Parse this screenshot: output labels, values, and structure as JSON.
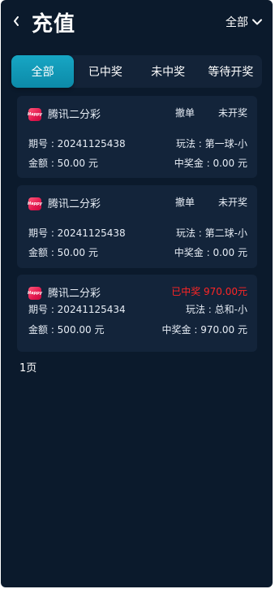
{
  "header": {
    "title": "充值",
    "filter_label": "全部"
  },
  "tabs": [
    {
      "label": "全部",
      "active": true
    },
    {
      "label": "已中奖",
      "active": false
    },
    {
      "label": "未中奖",
      "active": false
    },
    {
      "label": "等待开奖",
      "active": false
    }
  ],
  "records": [
    {
      "logo_text": "Happy",
      "game": "腾讯二分彩",
      "cancel_label": "撤单",
      "status": "未开奖",
      "period": "期号 : 20241125438",
      "play": "玩法 : 第一球-小",
      "amount": "金额 : 50.00 元",
      "prize": "中奖金 : 0.00 元"
    },
    {
      "logo_text": "Happy",
      "game": "腾讯二分彩",
      "cancel_label": "撤单",
      "status": "未开奖",
      "period": "期号 : 20241125438",
      "play": "玩法 : 第二球-小",
      "amount": "金额 : 50.00 元",
      "prize": "中奖金 : 0.00 元"
    },
    {
      "logo_text": "Happy",
      "game": "腾讯二分彩",
      "status": "已中奖 970.00元",
      "period": "期号 : 20241125434",
      "play": "玩法 : 总和-小",
      "amount": "金额 : 500.00 元",
      "prize": "中奖金 : 970.00 元"
    }
  ],
  "pagination": {
    "label": "1页"
  },
  "colors": {
    "background": "#0b1a2c",
    "card": "#13243a",
    "tab_active": "#17a6c4",
    "win_status": "#ff2525"
  }
}
